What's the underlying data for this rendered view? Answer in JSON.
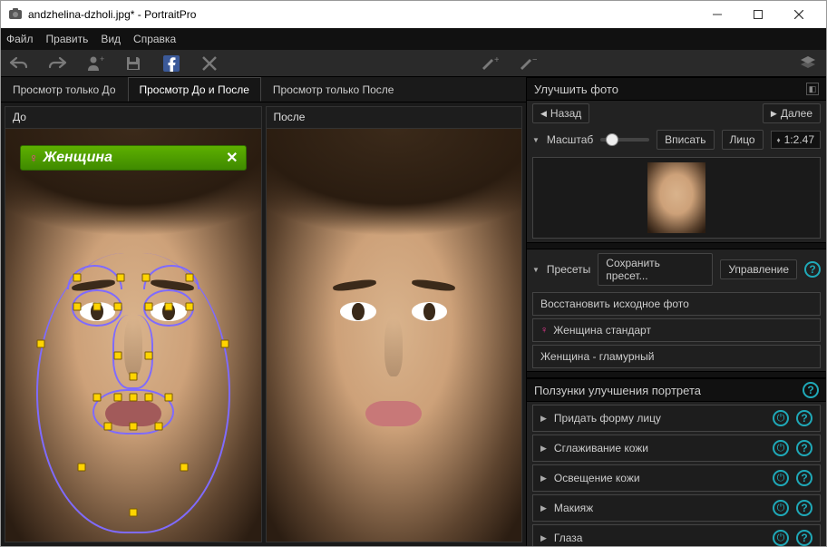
{
  "window": {
    "title": "andzhelina-dzholi.jpg* - PortraitPro"
  },
  "menu": {
    "file": "Файл",
    "edit": "Править",
    "view": "Вид",
    "help": "Справка"
  },
  "viewtabs": {
    "before_only": "Просмотр только До",
    "before_after": "Просмотр До и После",
    "after_only": "Просмотр только После"
  },
  "panes": {
    "before": "До",
    "after": "После"
  },
  "gender": {
    "label": "Женщина"
  },
  "right": {
    "enhance_title": "Улучшить фото",
    "back": "Назад",
    "next": "Далее",
    "zoom_label": "Масштаб",
    "fit": "Вписать",
    "face": "Лицо",
    "zoom_value": "1:2.47",
    "presets_label": "Пресеты",
    "save_preset": "Сохранить пресет...",
    "manage": "Управление",
    "preset_restore": "Восстановить исходное фото",
    "preset_female_std": "Женщина стандарт",
    "preset_female_glam": "Женщина - гламурный",
    "sliders_title": "Ползунки улучшения портрета",
    "sections": {
      "face_sculpt": "Придать форму лицу",
      "skin_smoothing": "Сглаживание кожи",
      "skin_lighting": "Освещение кожи",
      "makeup": "Макияж",
      "eyes": "Глаза"
    }
  }
}
